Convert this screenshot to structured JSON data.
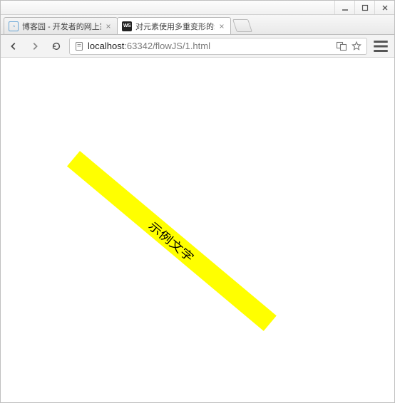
{
  "window_controls": {
    "minimize": "minimize",
    "maximize": "maximize",
    "close": "close"
  },
  "tabs": [
    {
      "title": "博客园 - 开发者的网上家",
      "active": false
    },
    {
      "title": "对元素使用多重变形的示",
      "active": true
    }
  ],
  "toolbar": {
    "back": "Back",
    "forward": "Forward",
    "reload": "Reload"
  },
  "omnibox": {
    "host": "localhost",
    "rest": ":63342/flowJS/1.html",
    "translate": "Translate",
    "star": "Bookmark"
  },
  "menu": {
    "label": "Menu"
  },
  "page": {
    "demo_text": "示例文字"
  }
}
